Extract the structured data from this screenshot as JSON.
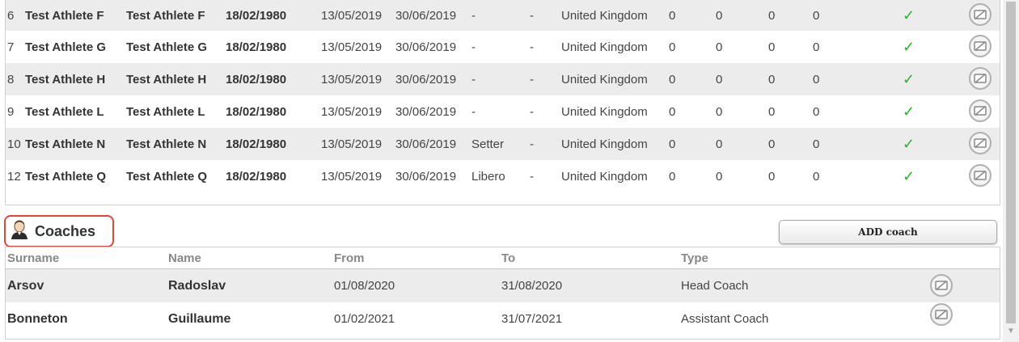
{
  "athletes": [
    {
      "no": "6",
      "surname": "Test Athlete F",
      "name": "Test Athlete F",
      "dob": "18/02/1980",
      "from": "13/05/2019",
      "to": "30/06/2019",
      "position": "-",
      "dash": "-",
      "country": "United Kingdom",
      "c1": "0",
      "c2": "0",
      "c3": "0",
      "c4": "0",
      "check": "✓"
    },
    {
      "no": "7",
      "surname": "Test Athlete G",
      "name": "Test Athlete G",
      "dob": "18/02/1980",
      "from": "13/05/2019",
      "to": "30/06/2019",
      "position": "-",
      "dash": "-",
      "country": "United Kingdom",
      "c1": "0",
      "c2": "0",
      "c3": "0",
      "c4": "0",
      "check": "✓"
    },
    {
      "no": "8",
      "surname": "Test Athlete H",
      "name": "Test Athlete H",
      "dob": "18/02/1980",
      "from": "13/05/2019",
      "to": "30/06/2019",
      "position": "-",
      "dash": "-",
      "country": "United Kingdom",
      "c1": "0",
      "c2": "0",
      "c3": "0",
      "c4": "0",
      "check": "✓"
    },
    {
      "no": "9",
      "surname": "Test Athlete L",
      "name": "Test Athlete L",
      "dob": "18/02/1980",
      "from": "13/05/2019",
      "to": "30/06/2019",
      "position": "-",
      "dash": "-",
      "country": "United Kingdom",
      "c1": "0",
      "c2": "0",
      "c3": "0",
      "c4": "0",
      "check": "✓"
    },
    {
      "no": "10",
      "surname": "Test Athlete N",
      "name": "Test Athlete N",
      "dob": "18/02/1980",
      "from": "13/05/2019",
      "to": "30/06/2019",
      "position": "Setter",
      "dash": "-",
      "country": "United Kingdom",
      "c1": "0",
      "c2": "0",
      "c3": "0",
      "c4": "0",
      "check": "✓"
    },
    {
      "no": "12",
      "surname": "Test Athlete Q",
      "name": "Test Athlete Q",
      "dob": "18/02/1980",
      "from": "13/05/2019",
      "to": "30/06/2019",
      "position": "Libero",
      "dash": "-",
      "country": "United Kingdom",
      "c1": "0",
      "c2": "0",
      "c3": "0",
      "c4": "0",
      "check": "✓"
    }
  ],
  "coaches_section": {
    "title": "Coaches",
    "add_button": "ADD coach",
    "columns": [
      "Surname",
      "Name",
      "From",
      "To",
      "Type"
    ],
    "rows": [
      {
        "surname": "Arsov",
        "name": "Radoslav",
        "from": "01/08/2020",
        "to": "31/08/2020",
        "type": "Head Coach"
      },
      {
        "surname": "Bonneton",
        "name": "Guillaume",
        "from": "01/02/2021",
        "to": "31/07/2021",
        "type": "Assistant Coach"
      }
    ]
  },
  "icons": {
    "check": "check-icon",
    "delete": "delete-icon",
    "coach": "coach-avatar-icon"
  },
  "colors": {
    "check": "#22bb22",
    "highlight_border": "#e0473a",
    "row_alt": "#ececec"
  }
}
